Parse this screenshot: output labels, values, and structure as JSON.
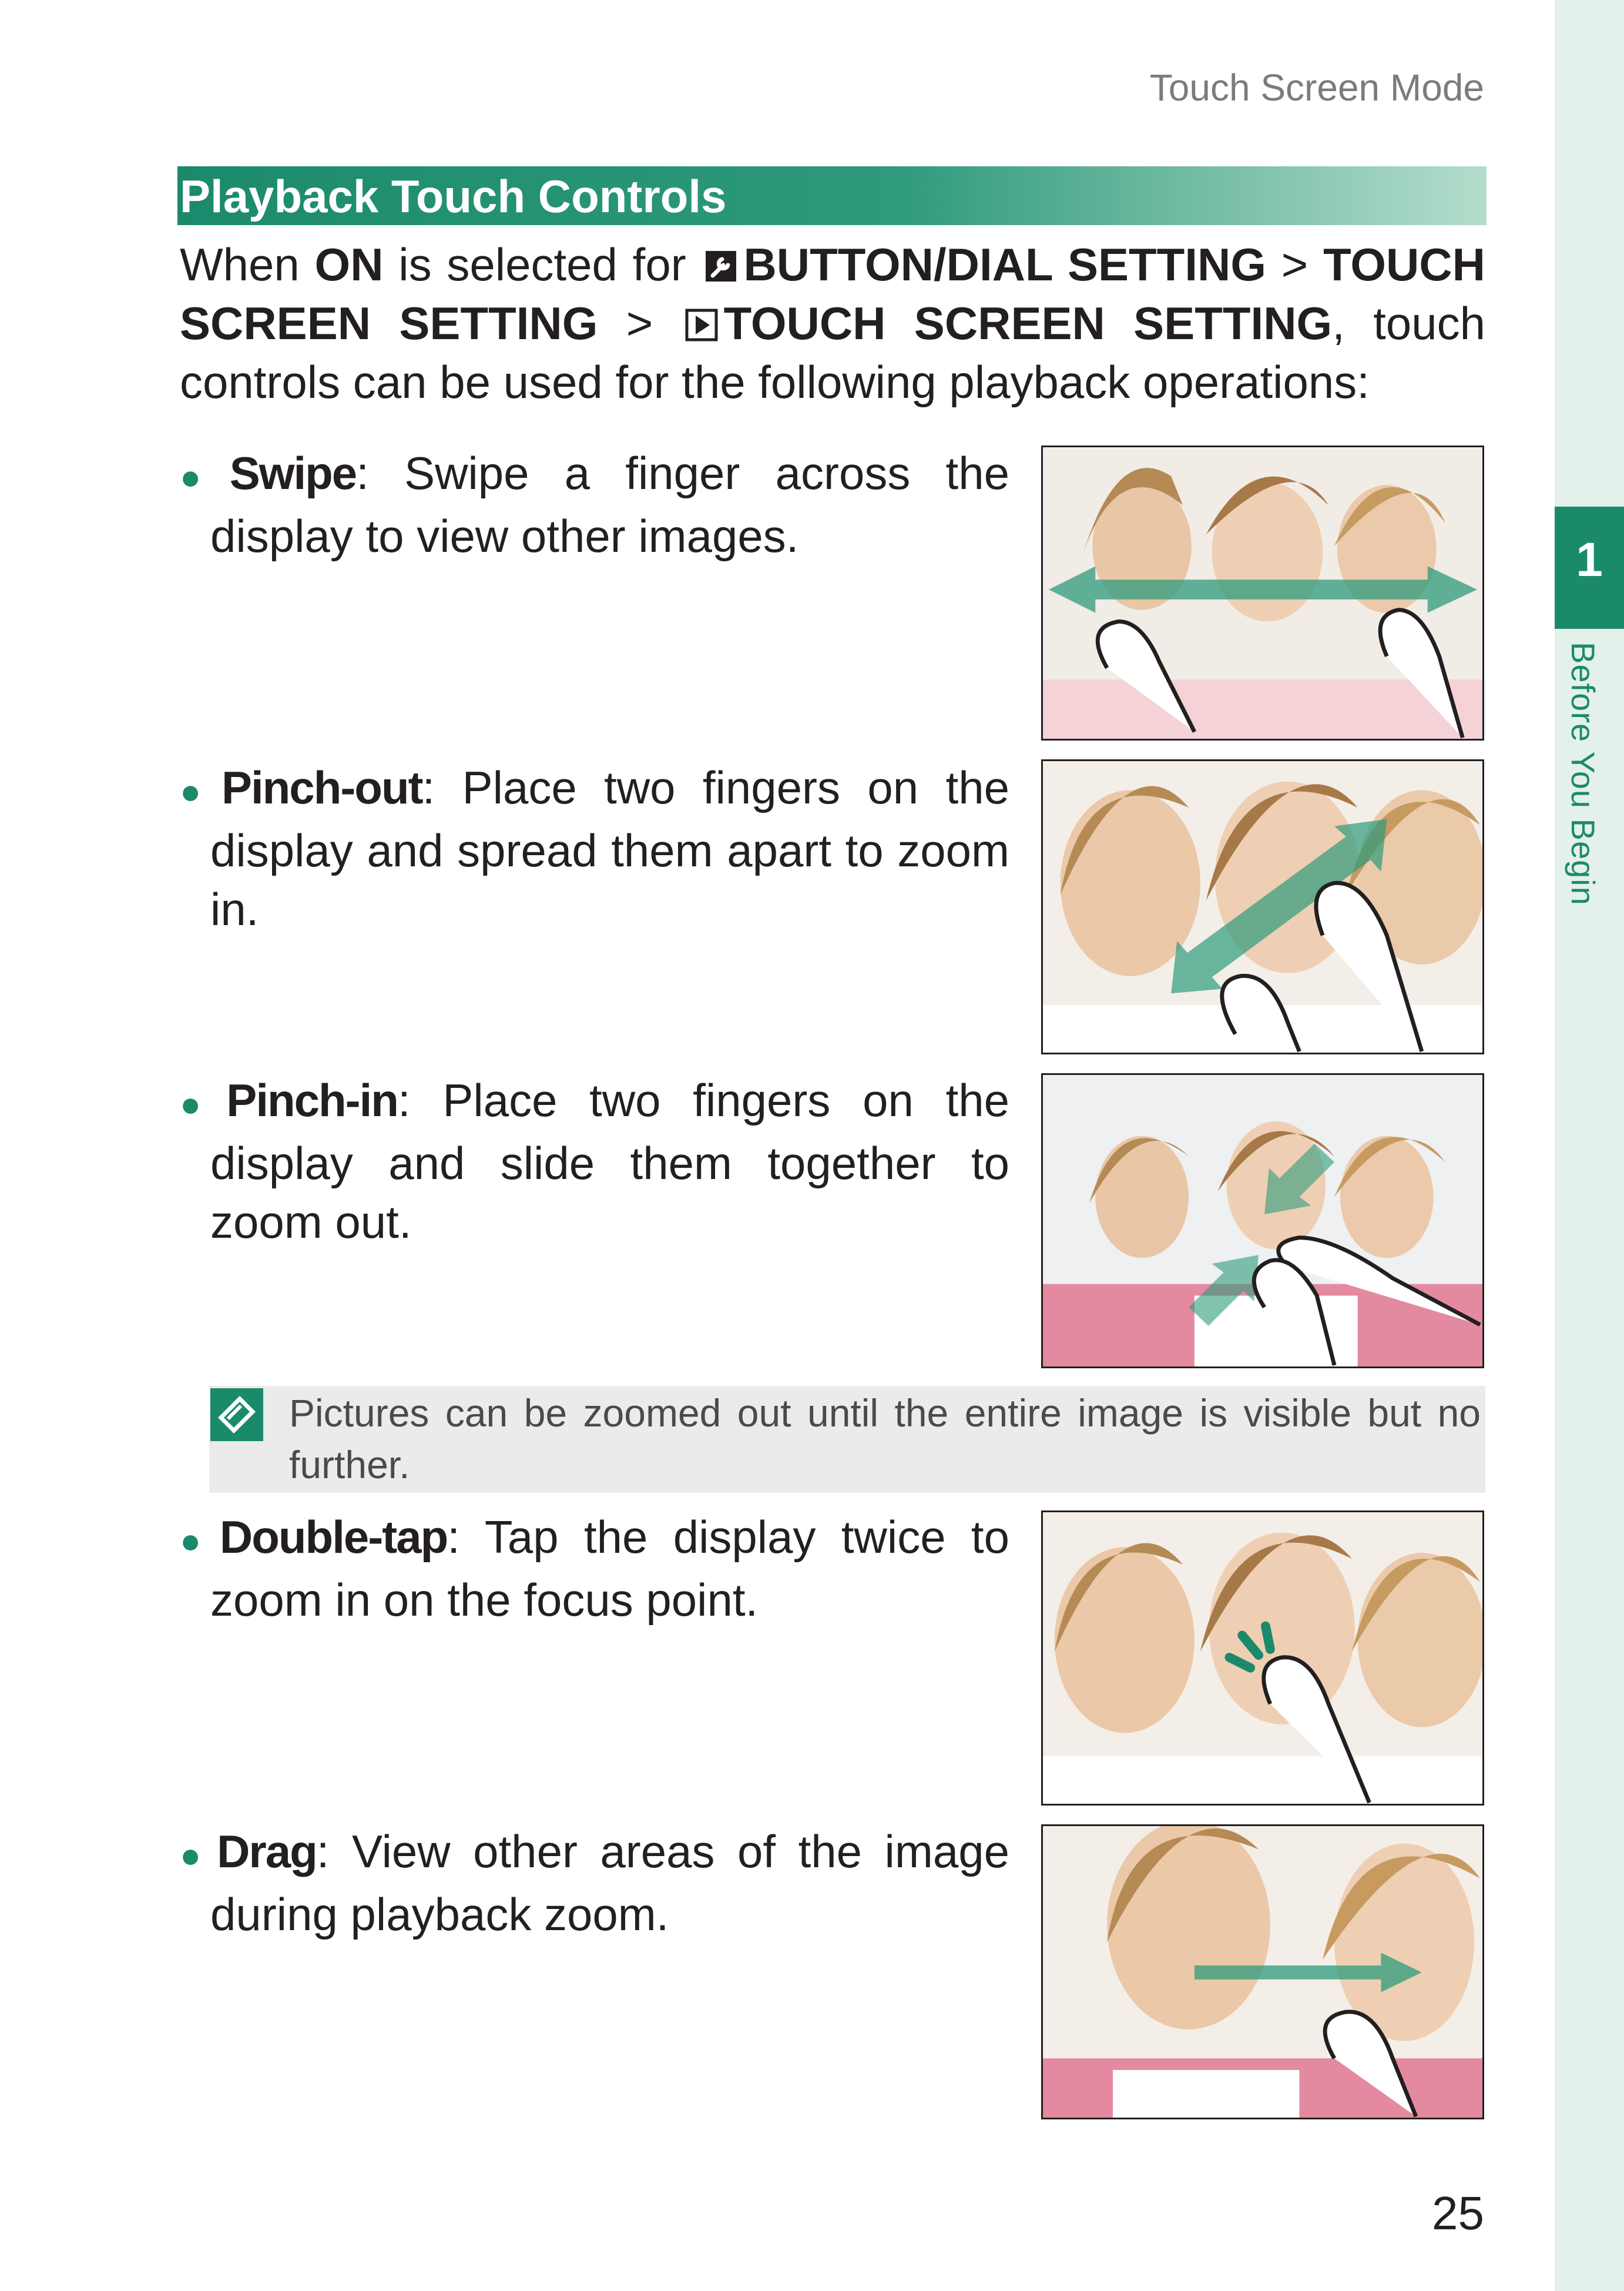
{
  "header": {
    "running_head": "Touch Screen Mode"
  },
  "side_tab": {
    "chapter_number": "1",
    "chapter_title": "Before You Begin"
  },
  "section": {
    "title": "Playback Touch Controls"
  },
  "intro": {
    "t1": "When ",
    "on": "ON",
    "t2": " is selected for ",
    "setup_icon": "wrench-setup-icon",
    "button_dial": "BUTTON/DIAL SETTING",
    "sep1": " > ",
    "touch_screen_setting": "TOUCH SCREEN SETTING",
    "sep2": " > ",
    "playback_icon": "playback-icon",
    "playback_touch": "TOUCH SCREEN SETTING",
    "t3": ", touch controls can be used for the following playback operations:"
  },
  "items": [
    {
      "term": "Swipe",
      "description": ": Swipe a finger across the display to view other images.",
      "illustration": "swipe-gesture"
    },
    {
      "term": "Pinch-out",
      "description": ": Place two fingers on the display and spread them apart to zoom in.",
      "illustration": "pinch-out-gesture"
    },
    {
      "term": "Pinch-in",
      "description": ": Place two fingers on the display and slide them together to zoom out.",
      "illustration": "pinch-in-gesture"
    },
    {
      "term": "Double-tap",
      "description": ": Tap the display twice to zoom in on the focus point.",
      "illustration": "double-tap-gesture"
    },
    {
      "term": "Drag",
      "description": ": View other areas of the image during playback zoom.",
      "illustration": "drag-gesture"
    }
  ],
  "note": {
    "icon": "note-icon",
    "text": "Pictures can be zoomed out until the entire image is visible but no further."
  },
  "footer": {
    "page_number": "25"
  },
  "colors": {
    "accent": "#1b8a6b",
    "side_band": "#e4f0ea",
    "note_bg": "#ebebeb"
  }
}
